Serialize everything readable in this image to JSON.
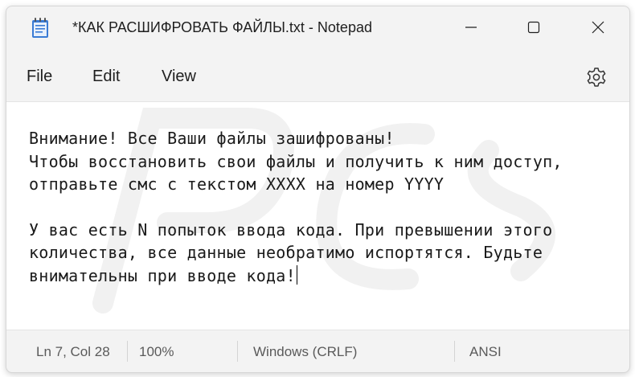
{
  "window": {
    "title": "*КАК РАСШИФРОВАТЬ ФАЙЛЫ.txt - Notepad",
    "app_icon": "notepad-icon",
    "controls": [
      "minimize-icon",
      "maximize-icon",
      "close-icon"
    ]
  },
  "menu": {
    "file": "File",
    "edit": "Edit",
    "view": "View",
    "settings_icon": "gear-icon"
  },
  "editor": {
    "lines": [
      "Внимание! Все Ваши файлы зашифрованы!",
      "Чтобы восстановить свои файлы и получить к ним доступ,",
      "отправьте смс с текстом XXXX на номер YYYY",
      "",
      "У вас есть N попыток ввода кода. При превышении этого",
      "количества, все данные необратимо испортятся. Будьте",
      "внимательны при вводе кода!"
    ]
  },
  "status": {
    "position": "Ln 7, Col 28",
    "zoom": "100%",
    "line_ending": "Windows (CRLF)",
    "encoding": "ANSI"
  },
  "colors": {
    "window_bg": "#f3f3f3",
    "editor_bg": "#ffffff",
    "text": "#1a1a1a",
    "status_text": "#5a5a5a"
  }
}
